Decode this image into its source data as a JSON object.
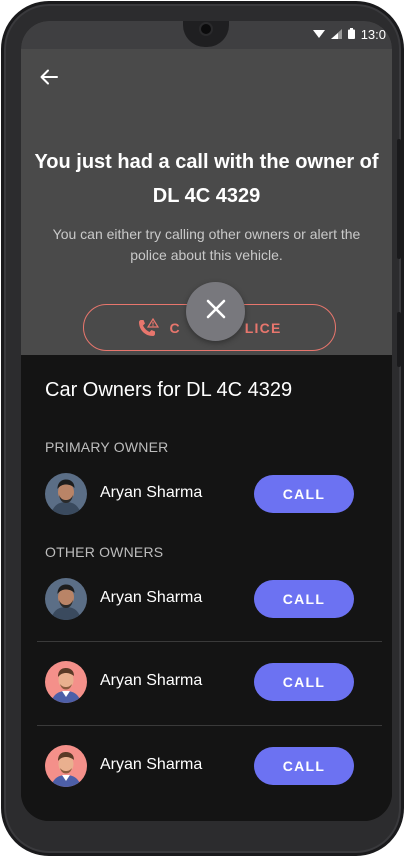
{
  "status_bar": {
    "time": "13:0"
  },
  "header": {
    "headline_line1": "You just had a call with the owner of",
    "headline_line2": "DL 4C 4329",
    "subtext": "You can either try calling other owners or alert the police about this vehicle.",
    "police_button_left": "C",
    "police_button_right": "LICE"
  },
  "owners": {
    "title": "Car Owners for DL 4C 4329",
    "primary_label": "PRIMARY OWNER",
    "others_label": "OTHER OWNERS",
    "primary": {
      "name": "Aryan Sharma",
      "call_label": "CALL"
    },
    "others": [
      {
        "name": "Aryan Sharma",
        "call_label": "CALL"
      },
      {
        "name": "Aryan Sharma",
        "call_label": "CALL"
      },
      {
        "name": "Aryan Sharma",
        "call_label": "CALL"
      }
    ]
  },
  "colors": {
    "accent": "#6c72f2",
    "police": "#e8766d",
    "top_panel": "#4a4a4a",
    "sheet": "#141414"
  }
}
